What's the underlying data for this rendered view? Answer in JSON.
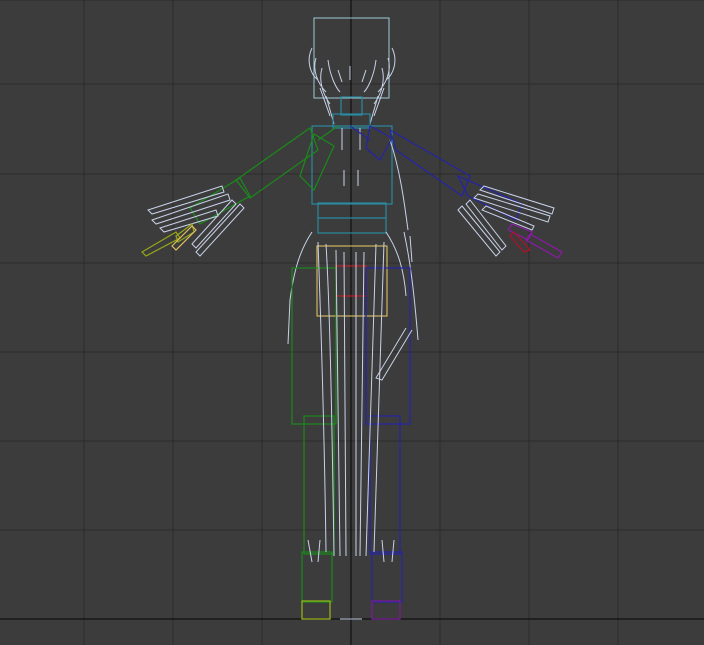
{
  "viewport": {
    "view": "front",
    "shading": "wireframe",
    "grid_visible": true,
    "background_color": "#3c3c3c",
    "grid_color": "#2a2a2a",
    "world_axis_color": "#0f0f0f"
  },
  "rig": {
    "left_side_bone_color": "#1a8a1a",
    "right_side_bone_color": "#2424a6",
    "spine_bone_color": "#2a8aa0",
    "mesh_wire_color": "#c8d2e8",
    "pelvis_color": "#e0c060",
    "root_color": "#c01c28",
    "left_hand_finger_color": "#98a818",
    "right_hand_finger_color": "#8c1aa8",
    "right_hand_accent_color": "#b0102a",
    "left_toe_color": "#9ab818",
    "right_toe_color": "#7a1a9a"
  }
}
